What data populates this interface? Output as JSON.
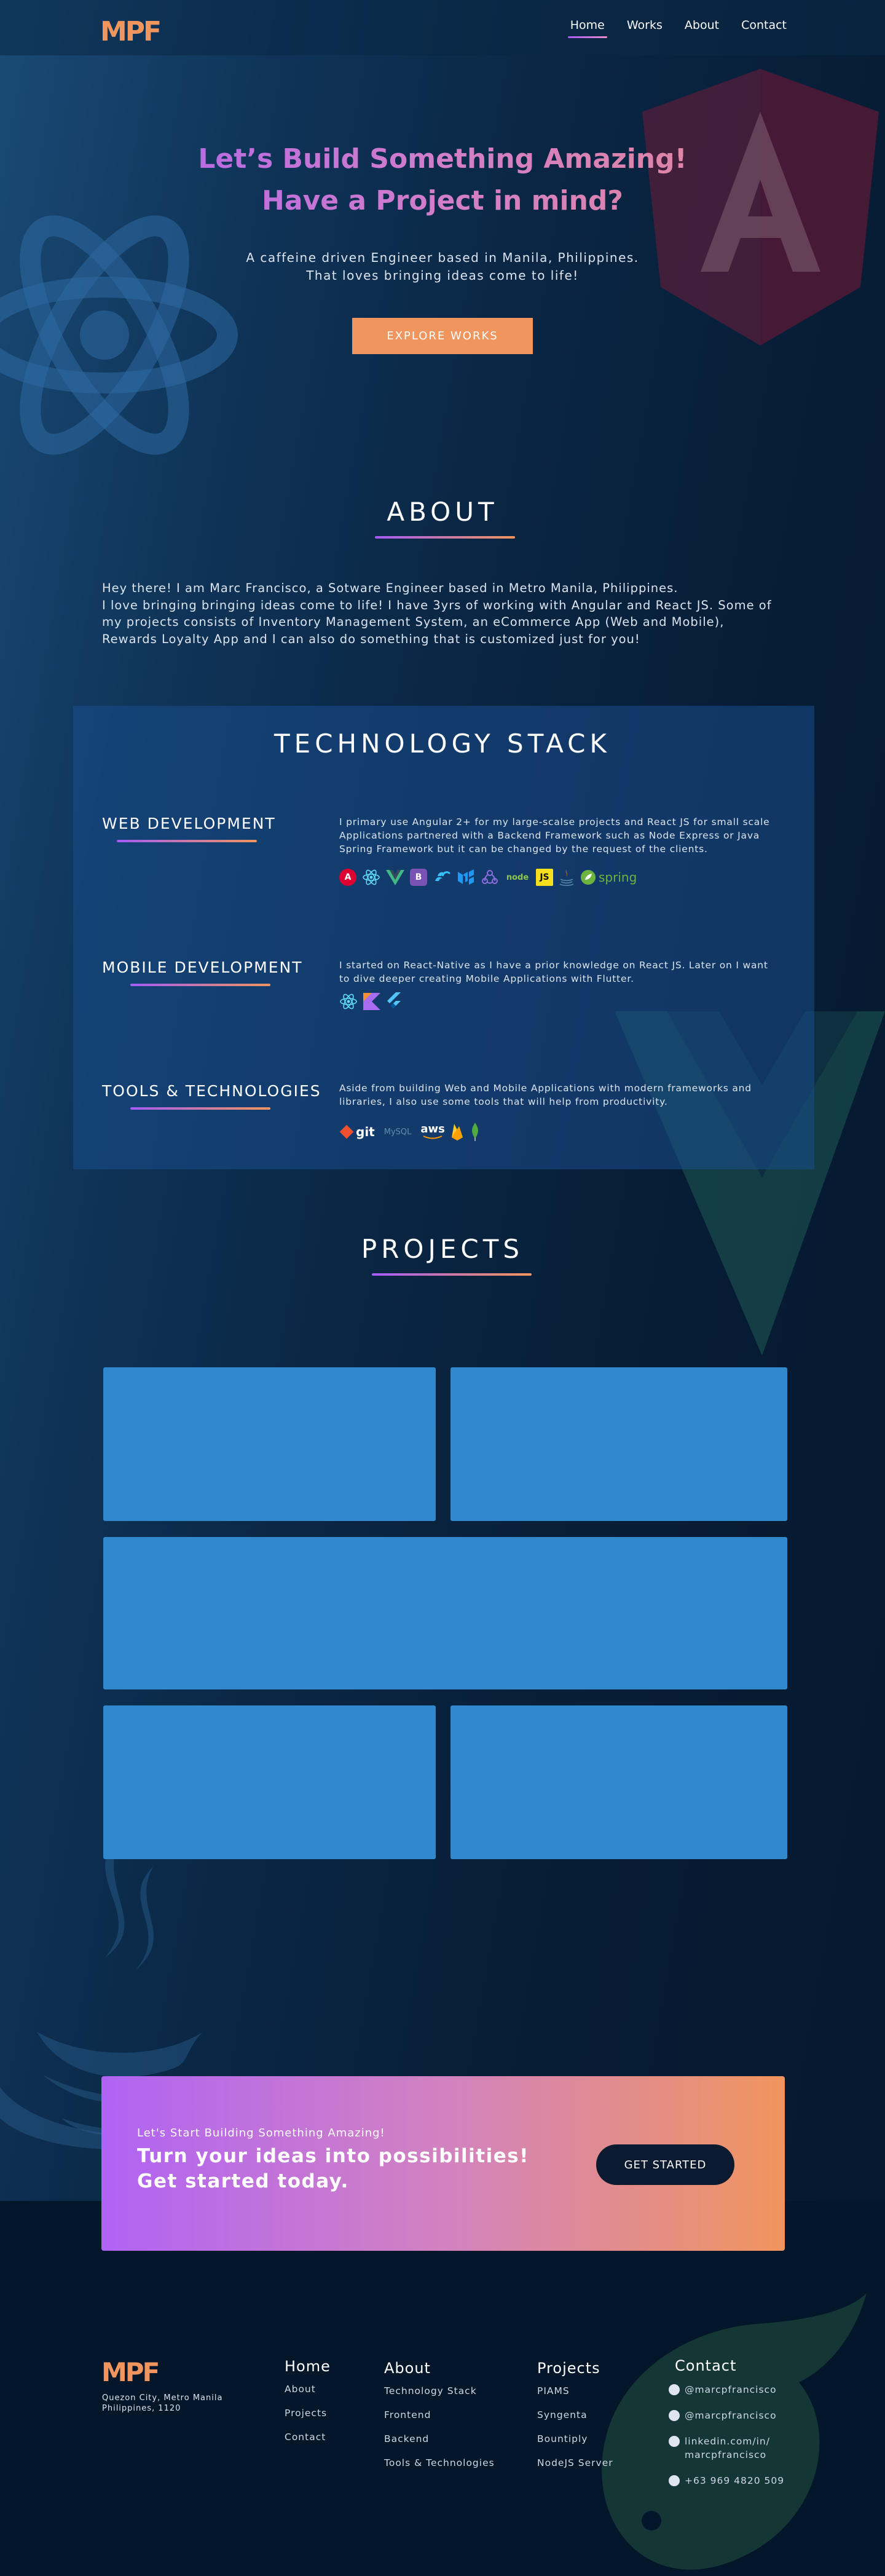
{
  "colors": {
    "accent_orange": "#f0955e",
    "accent_purple": "#a55cf5",
    "project_card": "#3188cd",
    "background": "#031729"
  },
  "header": {
    "logo": "MPF",
    "nav": [
      {
        "label": "Home",
        "active": true
      },
      {
        "label": "Works"
      },
      {
        "label": "About"
      },
      {
        "label": "Contact"
      }
    ]
  },
  "hero": {
    "title_line1": "Let’s Build Something Amazing!",
    "title_line2": "Have a Project in mind?",
    "subtitle_line1": "A caffeine driven Engineer based in Manila, Philippines.",
    "subtitle_line2": "That loves bringing ideas come to life!",
    "button": "EXPLORE WORKS"
  },
  "about": {
    "title": "ABOUT",
    "line1": "Hey there! I am Marc Francisco, a Sotware Engineer based in Metro Manila, Philippines.",
    "line2": "I love bringing bringing ideas come to life! I have 3yrs of working with Angular and React JS. Some of",
    "line3": "my projects consists of Inventory Management System, an eCommerce App (Web and Mobile),",
    "line4": "Rewards Loyalty App and I can also do something that is customized just for you!"
  },
  "tech": {
    "title": "TECHNOLOGY STACK",
    "web": {
      "label": "WEB DEVELOPMENT",
      "desc1": "I primary use Angular 2+ for my large-scalse projects and React JS for small scale",
      "desc2": "Applications partnered with a Backend Framework such as Node Express or Java",
      "desc3": "Spring Framework but it can be changed by the request of the clients.",
      "icons": [
        "angular-icon",
        "react-icon",
        "vue-icon",
        "bootstrap-icon",
        "tailwind-icon",
        "mui-icon",
        "redux-icon",
        "nodejs-icon",
        "javascript-icon",
        "java-icon",
        "spring-icon"
      ],
      "icon_text": {
        "bootstrap": "B",
        "js": "JS",
        "node": "node",
        "spring": "spring"
      }
    },
    "mobile": {
      "label": "MOBILE DEVELOPMENT",
      "desc1": "I started on React-Native as I have a prior knowledge on React JS. Later on I want",
      "desc2": "to dive deeper creating Mobile Applications with Flutter.",
      "icons": [
        "react-native-icon",
        "kotlin-icon",
        "flutter-icon"
      ]
    },
    "tools": {
      "label": "TOOLS & TECHNOLOGIES",
      "desc1": "Aside from building Web and Mobile Applications with modern frameworks and",
      "desc2": "libraries, I also use some tools that will help from productivity.",
      "icons": [
        "git-icon",
        "mysql-icon",
        "aws-icon",
        "firebase-icon",
        "mongodb-icon"
      ],
      "icon_text": {
        "git": "git",
        "mysql": "MySQL",
        "aws": "aws"
      }
    }
  },
  "projects": {
    "title": "PROJECTS"
  },
  "cta": {
    "small": "Let's Start Building Something Amazing!",
    "big_line1": "Turn your ideas into possibilities!",
    "big_line2": "Get started today.",
    "button": "GET STARTED"
  },
  "footer": {
    "logo": "MPF",
    "address_line1": "Quezon City, Metro Manila",
    "address_line2": "Philippines, 1120",
    "home": {
      "title": "Home",
      "links": [
        "About",
        "Projects",
        "Contact"
      ]
    },
    "about": {
      "title": "About",
      "links": [
        "Technology Stack",
        "Frontend",
        "Backend",
        "Tools & Technologies"
      ]
    },
    "projects": {
      "title": "Projects",
      "links": [
        "PIAMS",
        "Syngenta",
        "Bountiply",
        "NodeJS Server"
      ]
    },
    "contact": {
      "title": "Contact",
      "github": "@marcpfrancisco",
      "facebook": "@marcpfrancisco",
      "linkedin_line1": "linkedin.com/in/",
      "linkedin_line2": "marcpfrancisco",
      "phone": "+63 969 4820 509"
    }
  }
}
